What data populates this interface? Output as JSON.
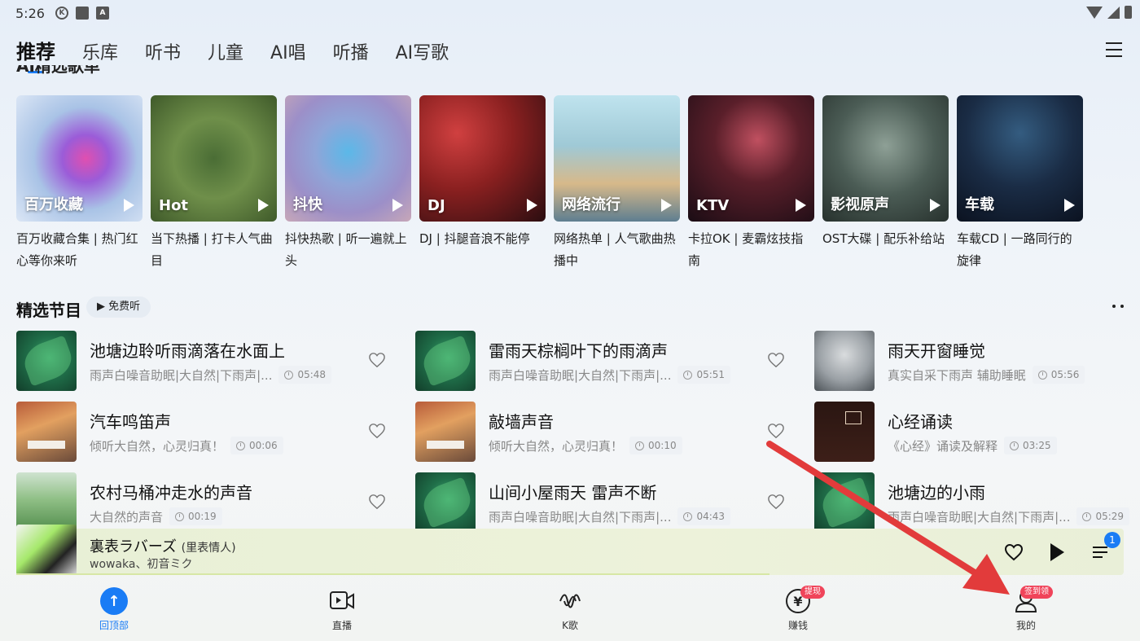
{
  "status_bar": {
    "time": "5:26",
    "left_icons": [
      "k-icon",
      "gallery-icon",
      "a-icon"
    ],
    "right_icons": [
      "wifi-icon",
      "signal-icon",
      "battery-icon"
    ]
  },
  "nav": {
    "tabs": [
      {
        "label": "推荐",
        "active": true
      },
      {
        "label": "乐库"
      },
      {
        "label": "听书"
      },
      {
        "label": "儿童"
      },
      {
        "label": "AI唱"
      },
      {
        "label": "听播"
      },
      {
        "label": "AI写歌"
      }
    ]
  },
  "partial_heading": "AI精选歌单",
  "playlists": [
    {
      "tag": "百万收藏",
      "desc": "百万收藏合集 | 热门红心等你来听"
    },
    {
      "tag": "Hot",
      "desc": "当下热播 | 打卡人气曲目"
    },
    {
      "tag": "抖快",
      "desc": "抖快热歌 | 听一遍就上头"
    },
    {
      "tag": "DJ",
      "desc": "DJ | 抖腿音浪不能停"
    },
    {
      "tag": "网络流行",
      "desc": "网络热单 | 人气歌曲热播中"
    },
    {
      "tag": "KTV",
      "desc": "卡拉OK | 麦霸炫技指南"
    },
    {
      "tag": "影视原声",
      "desc": "OST大碟 | 配乐补给站"
    },
    {
      "tag": "车载",
      "desc": "车载CD | 一路同行的旋律"
    }
  ],
  "section": {
    "title": "精选节目",
    "badge": "▶ 免费听"
  },
  "tracks": [
    {
      "title": "池塘边聆听雨滴落在水面上",
      "sub": "雨声白噪音助眠|大自然|下雨声|...",
      "duration": "05:48"
    },
    {
      "title": "雷雨天棕榈叶下的雨滴声",
      "sub": "雨声白噪音助眠|大自然|下雨声|...",
      "duration": "05:51"
    },
    {
      "title": "雨天开窗睡觉",
      "sub": "真实自采下雨声 辅助睡眠",
      "duration": "05:56"
    },
    {
      "title": "汽车鸣笛声",
      "sub": "倾听大自然，心灵归真！",
      "duration": "00:06"
    },
    {
      "title": "敲墙声音",
      "sub": "倾听大自然，心灵归真！",
      "duration": "00:10"
    },
    {
      "title": "心经诵读",
      "sub": "《心经》诵读及解释",
      "duration": "03:25"
    },
    {
      "title": "农村马桶冲走水的声音",
      "sub": "大自然的声音",
      "duration": "00:19"
    },
    {
      "title": "山间小屋雨天 雷声不断",
      "sub": "雨声白噪音助眠|大自然|下雨声|...",
      "duration": "04:43"
    },
    {
      "title": "池塘边的小雨",
      "sub": "雨声白噪音助眠|大自然|下雨声|...",
      "duration": "05:29"
    }
  ],
  "player": {
    "title": "裏表ラバーズ",
    "subtitle": "(里表情人)",
    "artist": "wowaka、初音ミク",
    "queue_count": "1",
    "progress": 0.68
  },
  "bottom_nav": [
    {
      "label": "回顶部",
      "icon": "arrow-up-icon",
      "active": true
    },
    {
      "label": "直播",
      "icon": "live-video-icon"
    },
    {
      "label": "K歌",
      "icon": "k-song-icon"
    },
    {
      "label": "赚钱",
      "icon": "yen-icon",
      "badge": "提现"
    },
    {
      "label": "我的",
      "icon": "user-icon",
      "badge": "签到领"
    }
  ],
  "colors": {
    "accent": "#1a7cf5",
    "badge": "#f0445a",
    "annotation_arrow": "#e23b3b"
  }
}
